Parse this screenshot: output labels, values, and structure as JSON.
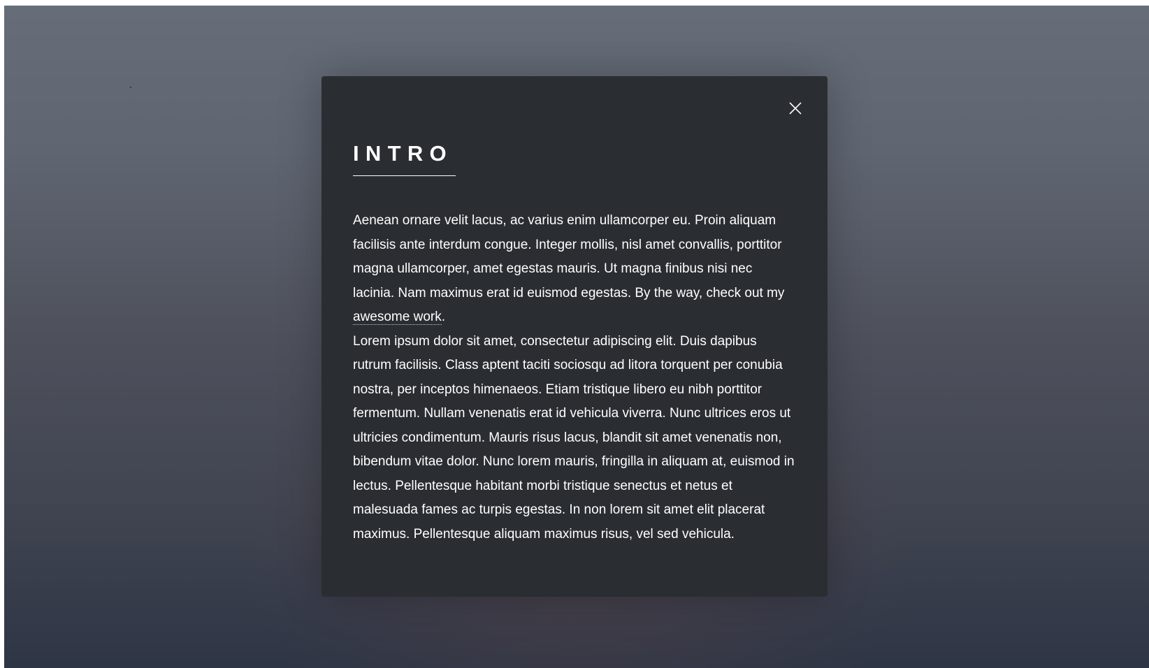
{
  "modal": {
    "title": "INTRO",
    "close_icon": "close-icon",
    "paragraph1": {
      "text_before_link": "Aenean ornare velit lacus, ac varius enim ullamcorper eu. Proin aliquam facilisis ante interdum congue. Integer mollis, nisl amet convallis, porttitor magna ullamcorper, amet egestas mauris. Ut magna finibus nisi nec lacinia. Nam maximus erat id euismod egestas. By the way, check out my ",
      "link_text": "awesome work",
      "text_after_link": "."
    },
    "paragraph2": "Lorem ipsum dolor sit amet, consectetur adipiscing elit. Duis dapibus rutrum facilisis. Class aptent taciti sociosqu ad litora torquent per conubia nostra, per inceptos himenaeos. Etiam tristique libero eu nibh porttitor fermentum. Nullam venenatis erat id vehicula viverra. Nunc ultrices eros ut ultricies condimentum. Mauris risus lacus, blandit sit amet venenatis non, bibendum vitae dolor. Nunc lorem mauris, fringilla in aliquam at, euismod in lectus. Pellentesque habitant morbi tristique senectus et netus et malesuada fames ac turpis egestas. In non lorem sit amet elit placerat maximus. Pellentesque aliquam maximus risus, vel sed vehicula."
  },
  "colors": {
    "modal_background": "#2a2d32",
    "text": "#ffffff"
  }
}
